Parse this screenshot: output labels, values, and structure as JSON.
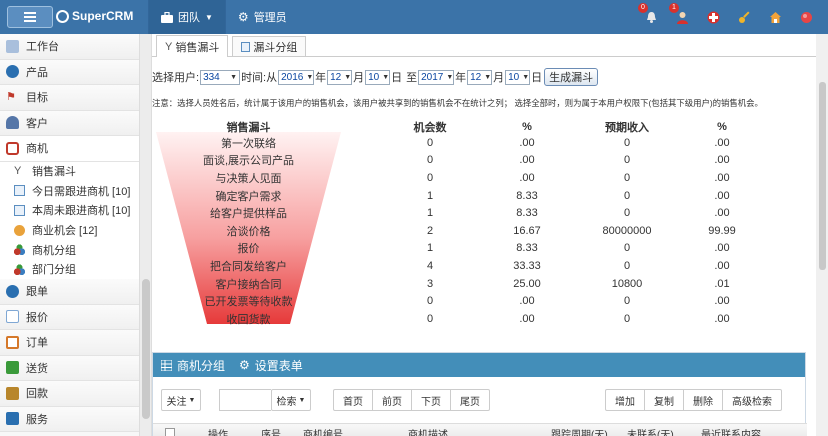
{
  "app": {
    "name": "SuperCRM"
  },
  "topnav": [
    {
      "label": "团队",
      "icon": "briefcase-icon",
      "dropdown": true
    },
    {
      "label": "管理员",
      "icon": "gear-icon",
      "dropdown": false
    }
  ],
  "top_icons": [
    {
      "icon": "alarm-icon",
      "badge": "0"
    },
    {
      "icon": "user-alert-icon",
      "badge": "1"
    },
    {
      "icon": "lifebuoy-icon",
      "badge": ""
    },
    {
      "icon": "key-icon",
      "badge": ""
    },
    {
      "icon": "home-icon",
      "badge": ""
    },
    {
      "icon": "power-icon",
      "badge": ""
    }
  ],
  "sidebar": {
    "items": [
      {
        "label": "工作台",
        "icon": "desk-icon",
        "color": "#7a9cc6"
      },
      {
        "label": "产品",
        "icon": "globe-icon",
        "color": "#2a6fb0"
      },
      {
        "label": "目标",
        "icon": "flag-icon",
        "color": "#c0392b"
      },
      {
        "label": "客户",
        "icon": "users-icon",
        "color": "#5576a8"
      },
      {
        "label": "商机",
        "icon": "briefcase-icon",
        "color": "#c0392b"
      }
    ],
    "sub_items": [
      {
        "label": "销售漏斗",
        "icon": "funnel-icon"
      },
      {
        "label": "今日需跟进商机 [10]",
        "icon": "doc-icon"
      },
      {
        "label": "本周未跟进商机 [10]",
        "icon": "doc-icon"
      },
      {
        "label": "商业机会 [12]",
        "icon": "coins-icon"
      },
      {
        "label": "商机分组",
        "icon": "group-icon"
      },
      {
        "label": "部门分组",
        "icon": "group-icon"
      }
    ],
    "bottom_items": [
      {
        "label": "跟单",
        "icon": "globe-icon",
        "color": "#2a6fb0"
      },
      {
        "label": "报价",
        "icon": "copy-icon",
        "color": "#7fa7d4"
      },
      {
        "label": "订单",
        "icon": "order-icon",
        "color": "#d5782a"
      },
      {
        "label": "送货",
        "icon": "truck-icon",
        "color": "#3a9a3a"
      },
      {
        "label": "回款",
        "icon": "money-icon",
        "color": "#b8862b"
      },
      {
        "label": "服务",
        "icon": "service-icon",
        "color": "#2a6fb0"
      }
    ]
  },
  "tabs": [
    {
      "label": "销售漏斗",
      "icon": "funnel-icon"
    },
    {
      "label": "漏斗分组",
      "icon": "doc-icon"
    }
  ],
  "filter": {
    "user_label": "选择用户:",
    "user_value": "334",
    "time_label": "时间:从",
    "from_year": "2016",
    "year_unit": "年",
    "from_month": "12",
    "month_unit": "月",
    "from_day": "10",
    "day_unit": "日",
    "to_label": "至",
    "to_year": "2017",
    "to_month": "12",
    "to_day": "10",
    "generate_button": "生成漏斗"
  },
  "note": "注意：选择人员姓名后，统计属于该用户的销售机会，该用户被共享到的销售机会不在统计之列；   选择全部时，则为属于本用户权限下(包括其下级用户)的销售机会。",
  "funnel": {
    "headers": {
      "stage": "销售漏斗",
      "count": "机会数",
      "pct": "%",
      "revenue": "预期收入",
      "pct2": "%"
    },
    "rows": [
      {
        "stage": "第一次联络",
        "count": "0",
        "pct": ".00",
        "revenue": "0",
        "pct2": ".00"
      },
      {
        "stage": "面谈,展示公司产品",
        "count": "0",
        "pct": ".00",
        "revenue": "0",
        "pct2": ".00"
      },
      {
        "stage": "与决策人见面",
        "count": "0",
        "pct": ".00",
        "revenue": "0",
        "pct2": ".00"
      },
      {
        "stage": "确定客户需求",
        "count": "1",
        "pct": "8.33",
        "revenue": "0",
        "pct2": ".00"
      },
      {
        "stage": "给客户提供样品",
        "count": "1",
        "pct": "8.33",
        "revenue": "0",
        "pct2": ".00"
      },
      {
        "stage": "洽谈价格",
        "count": "2",
        "pct": "16.67",
        "revenue": "80000000",
        "pct2": "99.99"
      },
      {
        "stage": "报价",
        "count": "1",
        "pct": "8.33",
        "revenue": "0",
        "pct2": ".00"
      },
      {
        "stage": "把合同发给客户",
        "count": "4",
        "pct": "33.33",
        "revenue": "0",
        "pct2": ".00"
      },
      {
        "stage": "客户接纳合同",
        "count": "3",
        "pct": "25.00",
        "revenue": "10800",
        "pct2": ".01"
      },
      {
        "stage": "已开发票等待收款",
        "count": "0",
        "pct": ".00",
        "revenue": "0",
        "pct2": ".00"
      },
      {
        "stage": "收回货款",
        "count": "0",
        "pct": ".00",
        "revenue": "0",
        "pct2": ".00"
      }
    ]
  },
  "panel": {
    "title": "商机分组",
    "settings": "设置表单",
    "attention_button": "关注",
    "search_button": "检索",
    "pager": [
      "首页",
      "前页",
      "下页",
      "尾页"
    ],
    "actions": [
      "增加",
      "复制",
      "删除",
      "高级检索"
    ],
    "table_headers": [
      "操作",
      "序号",
      "商机编号",
      "商机描述",
      "跟踪周期(天)",
      "未联系(天)",
      "最近联系内容"
    ]
  },
  "colors": {
    "topbar": "#3b73a8",
    "panel_head": "#438eb9",
    "funnel_top": "#fde8e8",
    "funnel_bottom": "#e63a3a"
  }
}
